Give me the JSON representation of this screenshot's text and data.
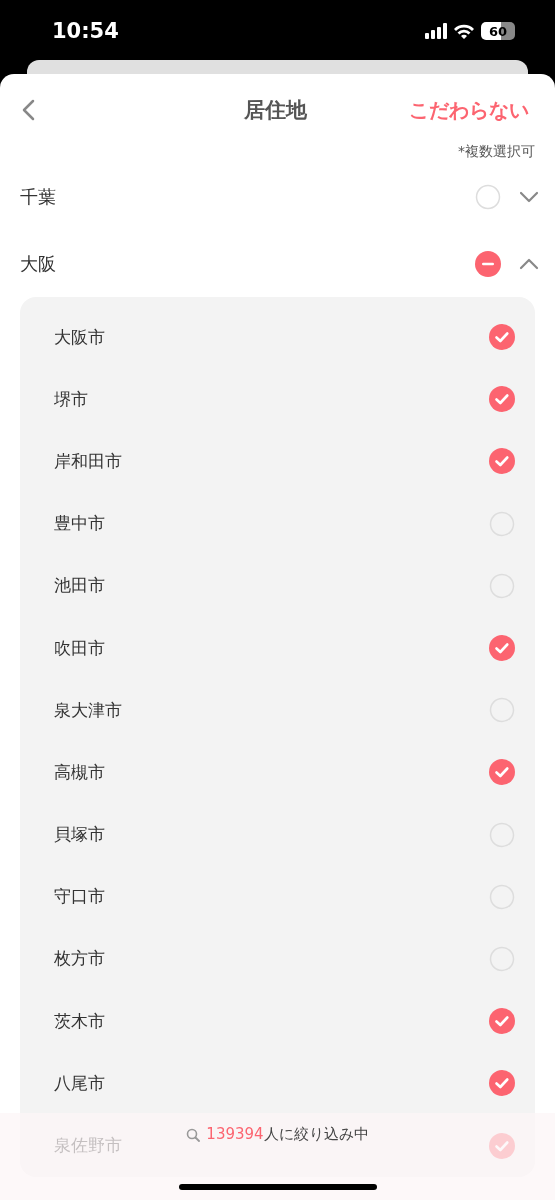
{
  "status_bar": {
    "time": "10:54",
    "battery": "60"
  },
  "header": {
    "title": "居住地",
    "action": "こだわらない"
  },
  "note": "*複数選択可",
  "prefectures": [
    {
      "name": "千葉",
      "checked": false,
      "partial": false,
      "expanded": false
    },
    {
      "name": "大阪",
      "checked": false,
      "partial": true,
      "expanded": true,
      "cities": [
        {
          "name": "大阪市",
          "checked": true
        },
        {
          "name": "堺市",
          "checked": true
        },
        {
          "name": "岸和田市",
          "checked": true
        },
        {
          "name": "豊中市",
          "checked": false
        },
        {
          "name": "池田市",
          "checked": false
        },
        {
          "name": "吹田市",
          "checked": true
        },
        {
          "name": "泉大津市",
          "checked": false
        },
        {
          "name": "高槻市",
          "checked": true
        },
        {
          "name": "貝塚市",
          "checked": false
        },
        {
          "name": "守口市",
          "checked": false
        },
        {
          "name": "枚方市",
          "checked": false
        },
        {
          "name": "茨木市",
          "checked": true
        },
        {
          "name": "八尾市",
          "checked": true
        },
        {
          "name": "泉佐野市",
          "checked": true
        }
      ]
    }
  ],
  "footer": {
    "count": "139394",
    "label": "人に絞り込み中"
  }
}
